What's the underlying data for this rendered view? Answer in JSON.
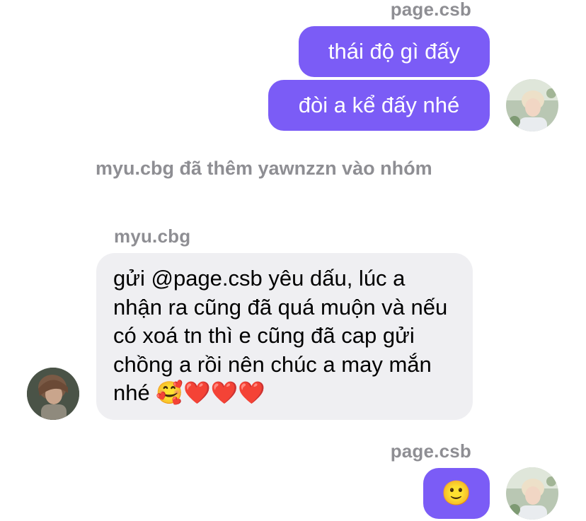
{
  "messages": {
    "group1": {
      "sender": "page.csb",
      "bubbles": [
        "thái độ gì đấy",
        "đòi a kể đấy nhé"
      ]
    },
    "system_notice": "myu.cbg đã thêm yawnzzn vào nhóm",
    "group2": {
      "sender": "myu.cbg",
      "text": "gửi @page.csb yêu dấu, lúc a nhận ra cũng đã quá muộn và nếu có xoá tn thì e cũng đã cap gửi chồng a rồi nên chúc a may mắn nhé",
      "emoji_face": "🥰",
      "emoji_hearts": "❤️❤️❤️"
    },
    "group3": {
      "sender": "page.csb",
      "emoji": "🙂"
    }
  },
  "colors": {
    "outgoing_bubble": "#7b5cf6",
    "incoming_bubble": "#efeff2",
    "sender_label": "#8e8e93"
  }
}
